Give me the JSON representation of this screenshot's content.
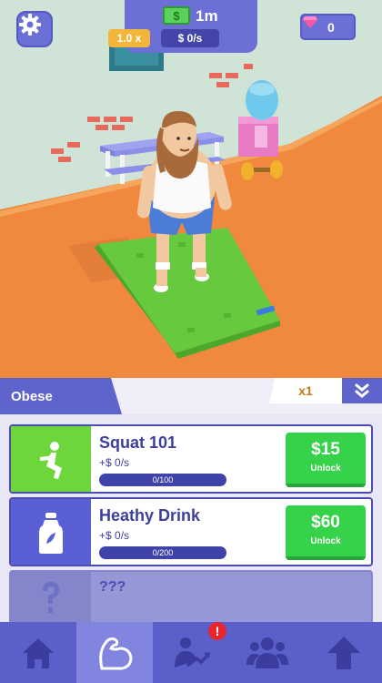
{
  "hud": {
    "money": "1m",
    "multiplier": "1.0 x",
    "income_rate": "$ 0/s",
    "gems": "0",
    "cash_symbol": "$"
  },
  "status": {
    "label": "Obese",
    "multiplier": "x1"
  },
  "cards": [
    {
      "title": "Squat 101",
      "income": "+$ 0/s",
      "progress": "0/100",
      "progress_fraction": 0,
      "price": "$15",
      "button": "Unlock",
      "icon": "squat-icon",
      "color": "#6dd63a"
    },
    {
      "title": "Heathy Drink",
      "income": "+$ 0/s",
      "progress": "0/200",
      "progress_fraction": 0,
      "price": "$60",
      "button": "Unlock",
      "icon": "bottle-icon",
      "color": "#5b5fd6"
    },
    {
      "title": "???",
      "icon": "question-icon"
    }
  ],
  "nav": {
    "items": [
      "home-icon",
      "muscle-icon",
      "progress-icon",
      "people-icon",
      "upgrade-arrow-icon"
    ],
    "active_index": 1,
    "badge": "!"
  },
  "colors": {
    "accent": "#6b6fd6",
    "buy_green": "#36d24a",
    "gold": "#f2b63a"
  }
}
